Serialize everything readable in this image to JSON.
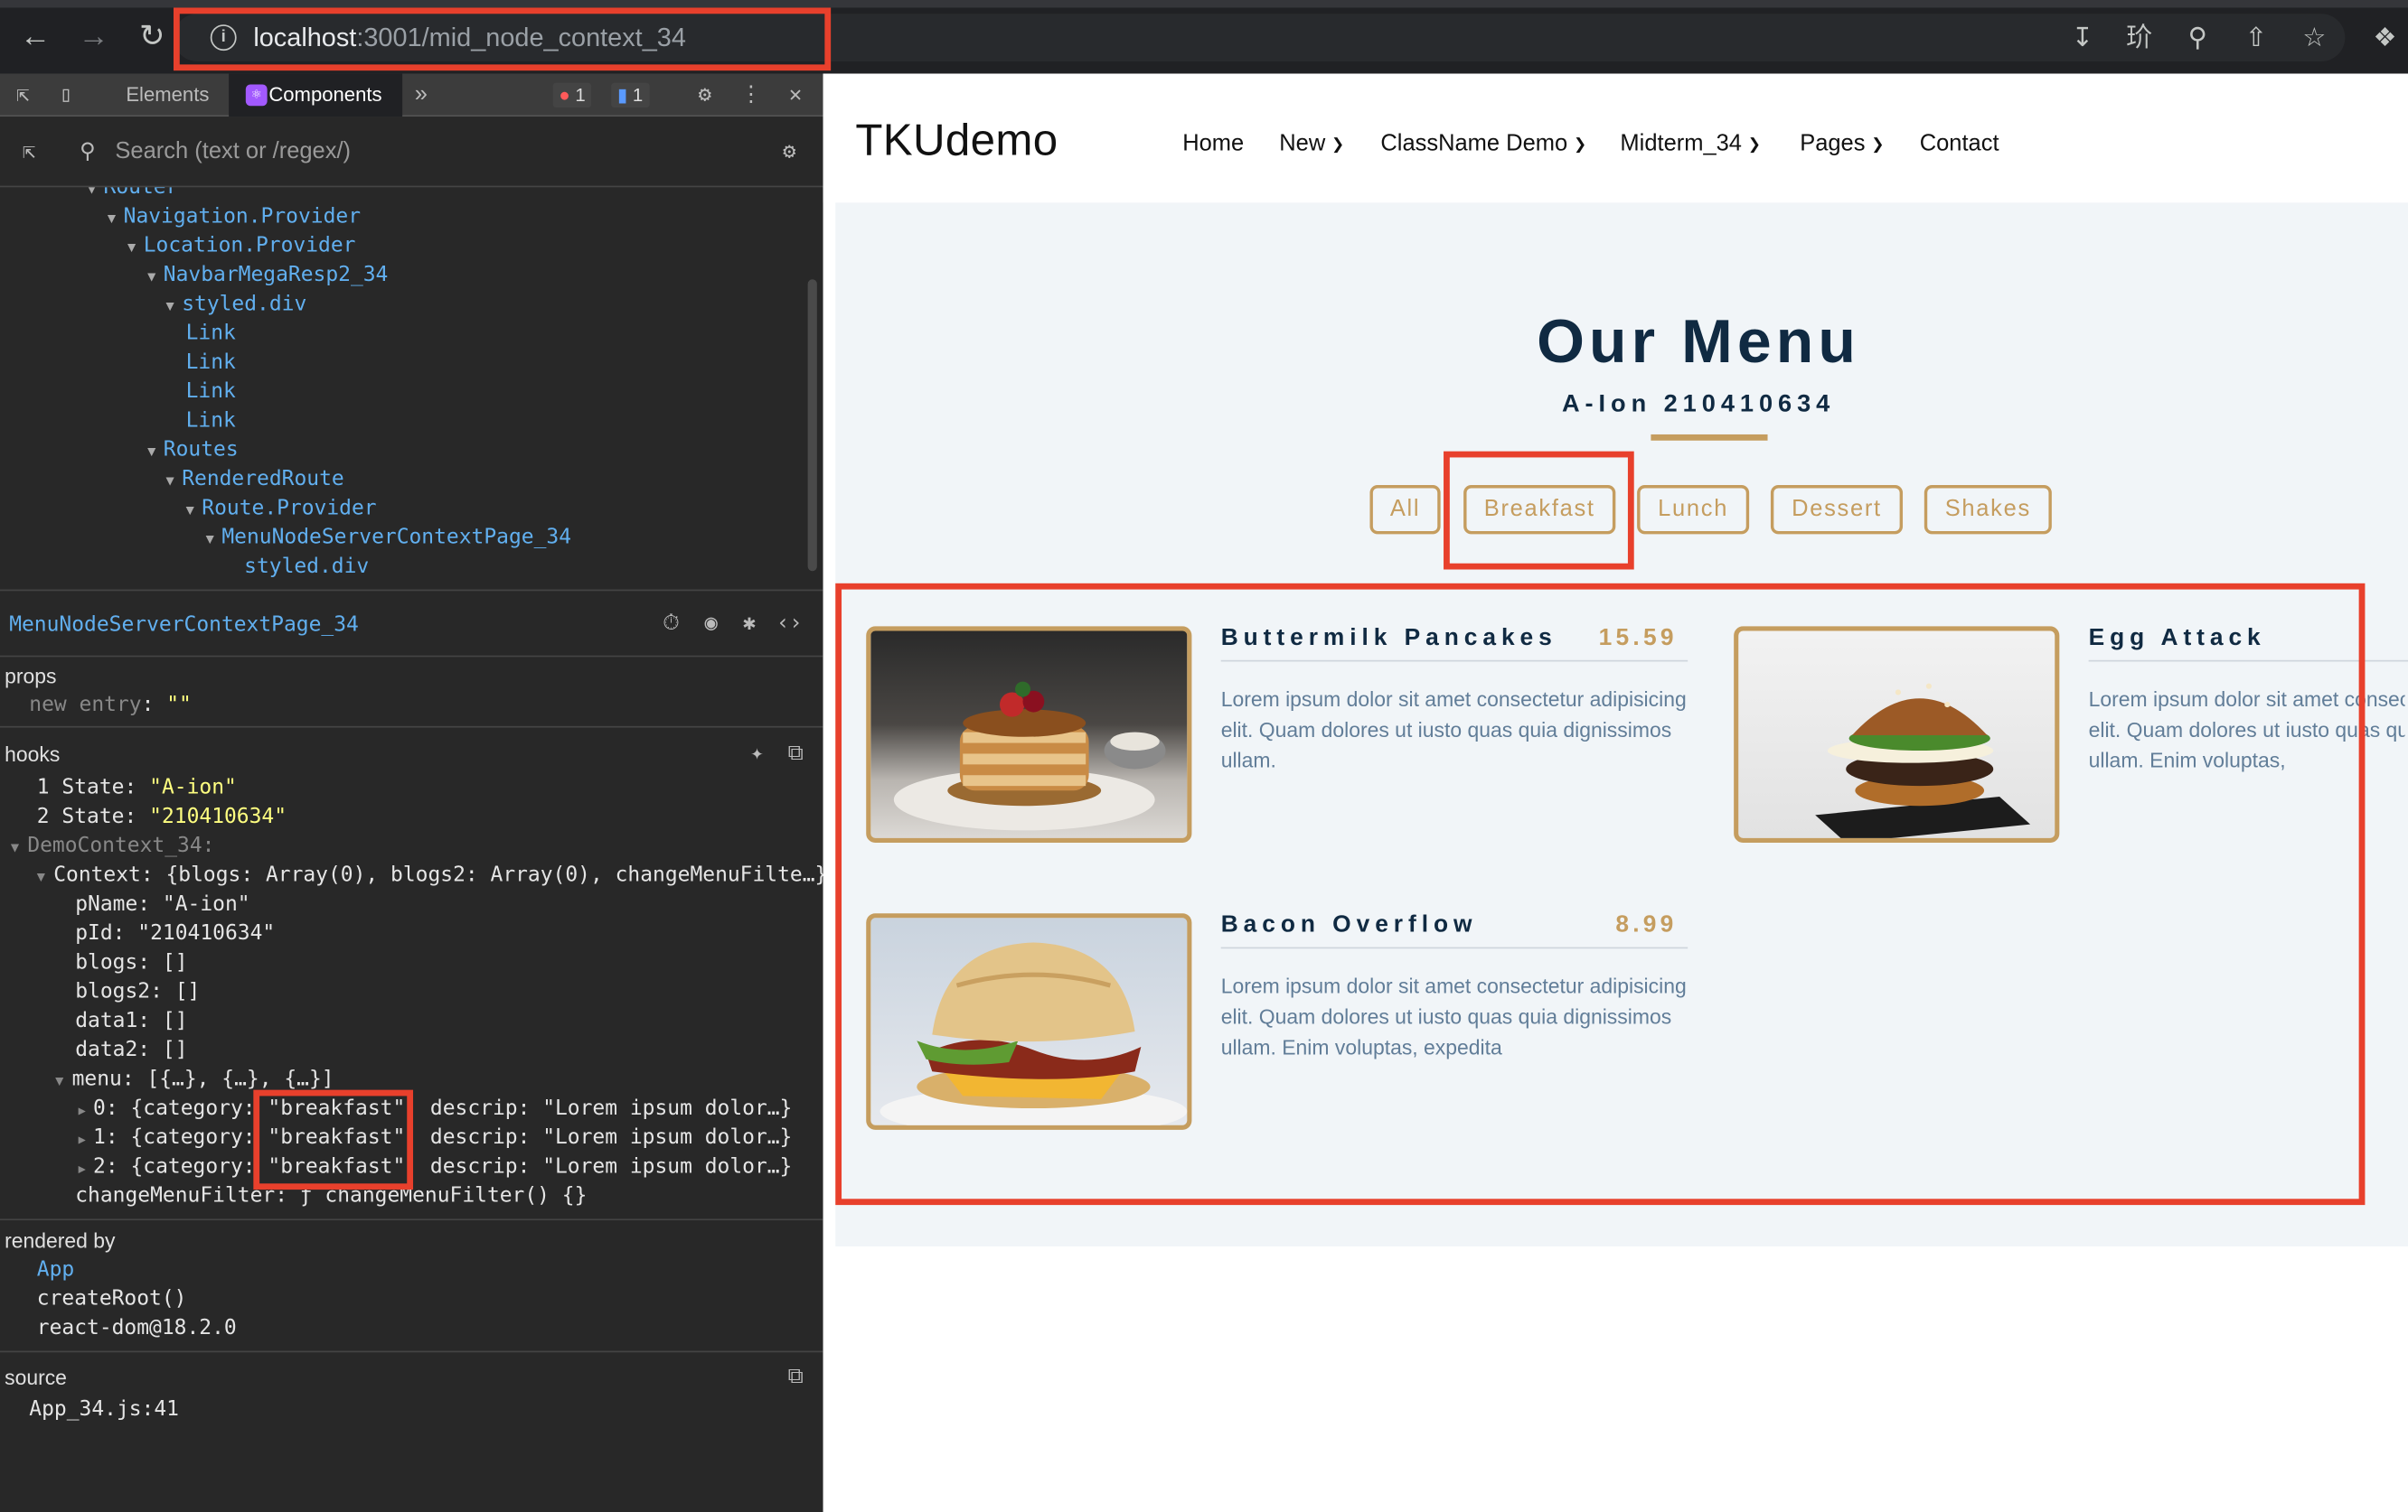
{
  "browser": {
    "url_host": "localhost",
    "url_rest": ":3001/mid_node_context_34",
    "icons": [
      "back-icon",
      "forward-icon",
      "reload-icon",
      "info-icon",
      "install-icon",
      "translate-icon",
      "zoom-icon",
      "share-icon",
      "star-icon",
      "extensions-icon"
    ]
  },
  "devtools": {
    "tabs": {
      "elements": "Elements",
      "components": "Components",
      "more": "»"
    },
    "badges": {
      "errors": "1",
      "messages": "1"
    },
    "search_placeholder": "Search (text or /regex/)",
    "tree": [
      {
        "label": "Router",
        "caret": true
      },
      {
        "label": "Navigation.Provider",
        "caret": true
      },
      {
        "label": "Location.Provider",
        "caret": true
      },
      {
        "label": "NavbarMegaResp2_34",
        "caret": true
      },
      {
        "label": "styled.div",
        "caret": true
      },
      {
        "label": "Link",
        "caret": false
      },
      {
        "label": "Link",
        "caret": false
      },
      {
        "label": "Link",
        "caret": false
      },
      {
        "label": "Link",
        "caret": false
      },
      {
        "label": "Routes",
        "caret": true
      },
      {
        "label": "RenderedRoute",
        "caret": true
      },
      {
        "label": "Route.Provider",
        "caret": true
      },
      {
        "label": "MenuNodeServerContextPage_34",
        "caret": true
      },
      {
        "label": "styled.div",
        "caret": false
      }
    ],
    "selected_component": "MenuNodeServerContextPage_34",
    "props": {
      "title": "props",
      "new_entry_label": "new entry",
      "new_entry_value": "\"\""
    },
    "hooks": {
      "title": "hooks",
      "state1_num": "1",
      "state1_key": "State:",
      "state1_val": "\"A-ion\"",
      "state2_num": "2",
      "state2_key": "State:",
      "state2_val": "\"210410634\"",
      "ctx_name": "DemoContext_34:",
      "context_line": "Context: {blogs: Array(0), blogs2: Array(0), changeMenuFilte…}",
      "pname": "pName: \"A-ion\"",
      "pid": "pId: \"210410634\"",
      "blogs": "blogs: []",
      "blogs2": "blogs2: []",
      "data1": "data1: []",
      "data2": "data2: []",
      "menu": "menu: [{…}, {…}, {…}]",
      "menu_items": [
        {
          "idx": "0:",
          "pre": "{category: ",
          "cat": "\"breakfast\"",
          "post": ", descrip: \"Lorem ipsum dolor…}"
        },
        {
          "idx": "1:",
          "pre": "{category: ",
          "cat": "\"breakfast\"",
          "post": ", descrip: \"Lorem ipsum dolor…}"
        },
        {
          "idx": "2:",
          "pre": "{category: ",
          "cat": "\"breakfast\"",
          "post": ", descrip: \"Lorem ipsum dolor…}"
        }
      ],
      "change_filter": "changeMenuFilter: ƒ changeMenuFilter() {}"
    },
    "rendered_by": {
      "title": "rendered by",
      "app": "App",
      "create_root": "createRoot()",
      "react_dom": "react-dom@18.2.0"
    },
    "source": {
      "title": "source",
      "file": "App_34.js:41"
    }
  },
  "site": {
    "logo": "TKUdemo",
    "nav": [
      "Home",
      "New",
      "ClassName Demo",
      "Midterm_34",
      "Pages",
      "Contact"
    ],
    "title": "Our Menu",
    "subtitle": "A-Ion 210410634",
    "filters": [
      "All",
      "Breakfast",
      "Lunch",
      "Dessert",
      "Shakes"
    ],
    "items": [
      {
        "title": "Buttermilk Pancakes",
        "price": "15.59",
        "desc": "Lorem ipsum dolor sit amet consectetur adipisicing elit. Quam dolores ut iusto quas quia dignissimos ullam."
      },
      {
        "title": "Egg Attack",
        "price": "",
        "desc": "Lorem ipsum dolor sit amet consectetur adipisicing elit. Quam dolores ut iusto quas quia dignissimos ullam. Enim voluptas,"
      },
      {
        "title": "Bacon Overflow",
        "price": "8.99",
        "desc": "Lorem ipsum dolor sit amet consectetur adipisicing elit. Quam dolores ut iusto quas quia dignissimos ullam. Enim voluptas, expedita"
      }
    ]
  },
  "colors": {
    "accent": "#c59d5f",
    "dark": "#102a42",
    "highlight": "#e8402c"
  }
}
